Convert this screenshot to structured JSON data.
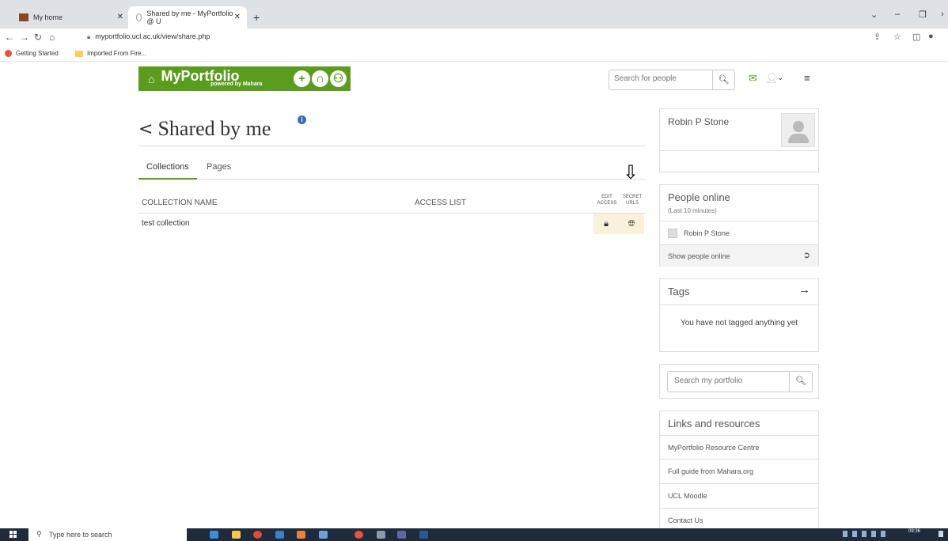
{
  "browser": {
    "tabs": [
      {
        "label": "My home",
        "active": false
      },
      {
        "label": "Shared by me - MyPortfolio @ U",
        "active": true
      }
    ],
    "url": "myportfolio.ucl.ac.uk/view/share.php",
    "bookmarks": [
      "Getting Started",
      "Imported From Fire..."
    ]
  },
  "header": {
    "brand": "MyPortfolio",
    "powered_by": "powered by Mahara",
    "search_placeholder": "Search for people"
  },
  "main": {
    "title": "Shared by me",
    "tabs": [
      "Collections",
      "Pages"
    ],
    "columns": {
      "name": "COLLECTION NAME",
      "access": "ACCESS LIST",
      "edit_access": "EDIT ACCESS",
      "secret_urls": "SECRET URLS"
    },
    "rows": [
      {
        "name": "test collection"
      }
    ]
  },
  "sidebar": {
    "user_name": "Robin P Stone",
    "online": {
      "title": "People online",
      "subtitle": "(Last 10 minutes)",
      "people": [
        "Robin P Stone"
      ],
      "show_more": "Show people online"
    },
    "tags": {
      "title": "Tags",
      "empty_message": "You have not tagged anything yet"
    },
    "portfolio_search_placeholder": "Search my portfolio",
    "links": {
      "title": "Links and resources",
      "items": [
        "MyPortfolio Resource Centre",
        "Full guide from Mahara.org",
        "UCL Moodle",
        "Contact Us"
      ]
    }
  },
  "taskbar": {
    "search_placeholder": "Type here to search",
    "time": "09:36"
  },
  "colors": {
    "brand_green": "#5b9c1e",
    "highlight_cell": "#faf1dd",
    "taskbar": "#1f2a3c"
  }
}
